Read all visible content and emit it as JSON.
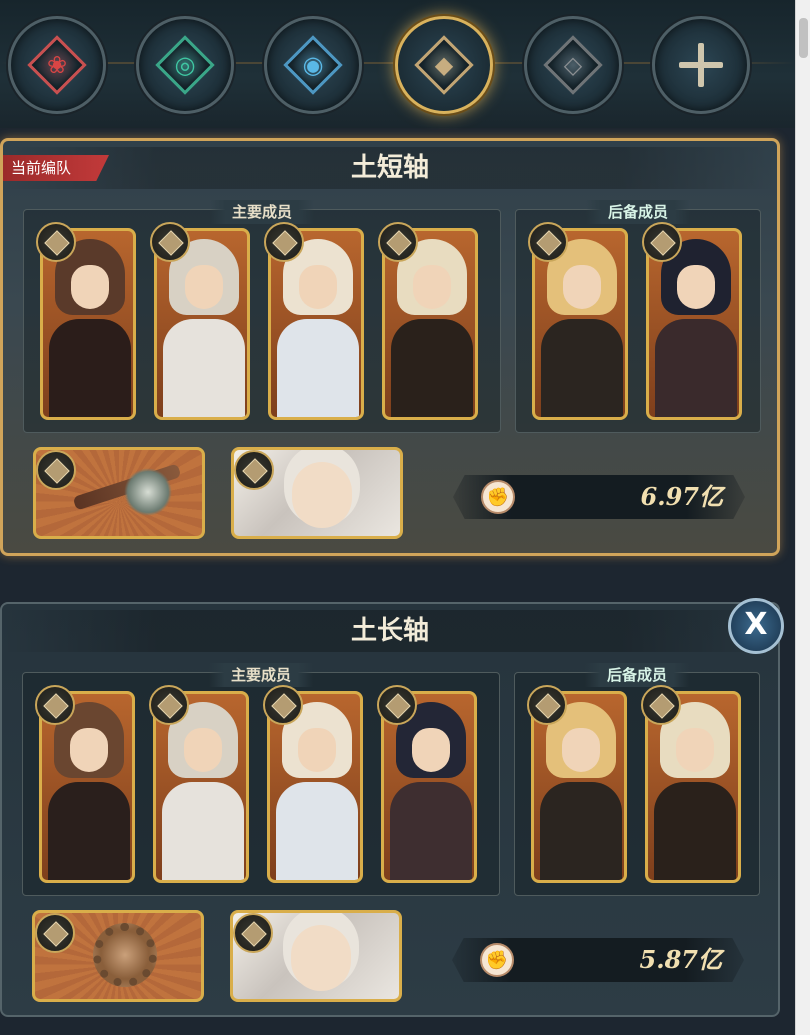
{
  "element_tabs": [
    {
      "name": "fire",
      "glyph": "❀",
      "color": "#d94545",
      "border": "#c85050",
      "active": false
    },
    {
      "name": "wind",
      "glyph": "◎",
      "color": "#3fc7a2",
      "border": "#3aa688",
      "active": false
    },
    {
      "name": "water",
      "glyph": "◉",
      "color": "#5ab8e6",
      "border": "#4d97c2",
      "active": false
    },
    {
      "name": "earth",
      "glyph": "◆",
      "color": "#c7ad80",
      "border": "#c2a574",
      "active": true
    },
    {
      "name": "void",
      "glyph": "◇",
      "color": "#8b8f92",
      "border": "#6f7477",
      "active": false
    },
    {
      "name": "add",
      "glyph": "",
      "color": "#cfc6ad",
      "border": "#4e5f66",
      "active": false
    }
  ],
  "teams": [
    {
      "name": "土短轴",
      "current_label": "当前编队",
      "main_label": "主要成员",
      "reserve_label": "后备成员",
      "power": "6.97亿",
      "main_members": [
        {
          "hair": "#5a3a2a",
          "body": "#2b1d1a"
        },
        {
          "hair": "#d8d1c4",
          "body": "#e6e2dc"
        },
        {
          "hair": "#ece2d0",
          "body": "#dfe4ea"
        },
        {
          "hair": "#e8dcc0",
          "body": "#2a211b"
        }
      ],
      "reserve_members": [
        {
          "hair": "#e4c07a",
          "body": "#2b2520"
        },
        {
          "hair": "#1f2230",
          "body": "#3a2a2c"
        }
      ],
      "weapon_style": "axe"
    },
    {
      "name": "土长轴",
      "main_label": "主要成员",
      "reserve_label": "后备成员",
      "power": "5.87亿",
      "close_label": "X",
      "main_members": [
        {
          "hair": "#6a4630",
          "body": "#2a1f1c"
        },
        {
          "hair": "#d8d1c4",
          "body": "#e6e2dc"
        },
        {
          "hair": "#ece2d0",
          "body": "#dfe4ea"
        },
        {
          "hair": "#232636",
          "body": "#3e2e30"
        }
      ],
      "reserve_members": [
        {
          "hair": "#e4c07a",
          "body": "#2b2520"
        },
        {
          "hair": "#e8dcc0",
          "body": "#2a211b"
        }
      ],
      "weapon_style": "ring"
    }
  ]
}
